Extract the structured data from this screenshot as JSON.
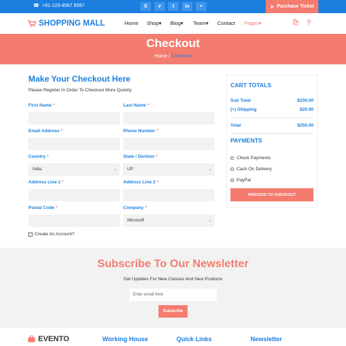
{
  "topbar": {
    "phone": "+91-123-4567 6587",
    "social_icons": [
      "skype-icon",
      "vimeo-icon",
      "twitter-icon",
      "linkedin-icon",
      "rss-icon"
    ],
    "social_glyphs": [
      "S",
      "v",
      "t",
      "in",
      "≡"
    ],
    "ticket_label": "Purchase Ticket"
  },
  "nav": {
    "brand": "SHOPPING MALL",
    "items": [
      "Home",
      "Shop",
      "Blog",
      "Team",
      "Contact",
      "Pages"
    ],
    "active": "Pages"
  },
  "hero": {
    "title": "Checkout",
    "crumb_home": "Home",
    "crumb_sep": "/",
    "crumb_current": "Checkout"
  },
  "form": {
    "title": "Make Your Checkout Here",
    "subtitle": "Please Register In Order To Checkout More Quickly",
    "required_mark": "*",
    "first_name": "First Name",
    "last_name": "Last Name",
    "email": "Email Address",
    "phone": "Phone Number",
    "country": "Country",
    "country_value": "India",
    "state": "State / Divition",
    "state_value": "UP",
    "address1": "Address Line 1",
    "address2": "Address Line 2",
    "postal": "Postal Code",
    "company": "Company",
    "company_value": "Microsoft",
    "create_account": "Create An Account?"
  },
  "cart": {
    "title": "CART TOTALS",
    "sub_total_label": "Sub Total",
    "sub_total_value": "$230.00",
    "shipping_label": "(+) Shipping",
    "shipping_value": "$20.00",
    "total_label": "Total",
    "total_value": "$250.00",
    "payments_title": "PAYMENTS",
    "payments": [
      "Check Payments",
      "Cash On Delivery",
      "PayPal"
    ],
    "proceed": "PROCEED TO CHECKOUT"
  },
  "newsletter": {
    "title": "Subscribe To Our Newsletter",
    "subtitle": "Get Updates For New Classes And New Products",
    "placeholder": "Enter email here",
    "button": "Subscribe"
  },
  "footer": {
    "brand": "EVENTO",
    "col1": "Working House",
    "col2": "Quick Links",
    "col3": "Newsletter"
  },
  "colors": {
    "primary": "#1c7fe0",
    "accent": "#f47c6f",
    "light_bg": "#f2f2f2"
  }
}
